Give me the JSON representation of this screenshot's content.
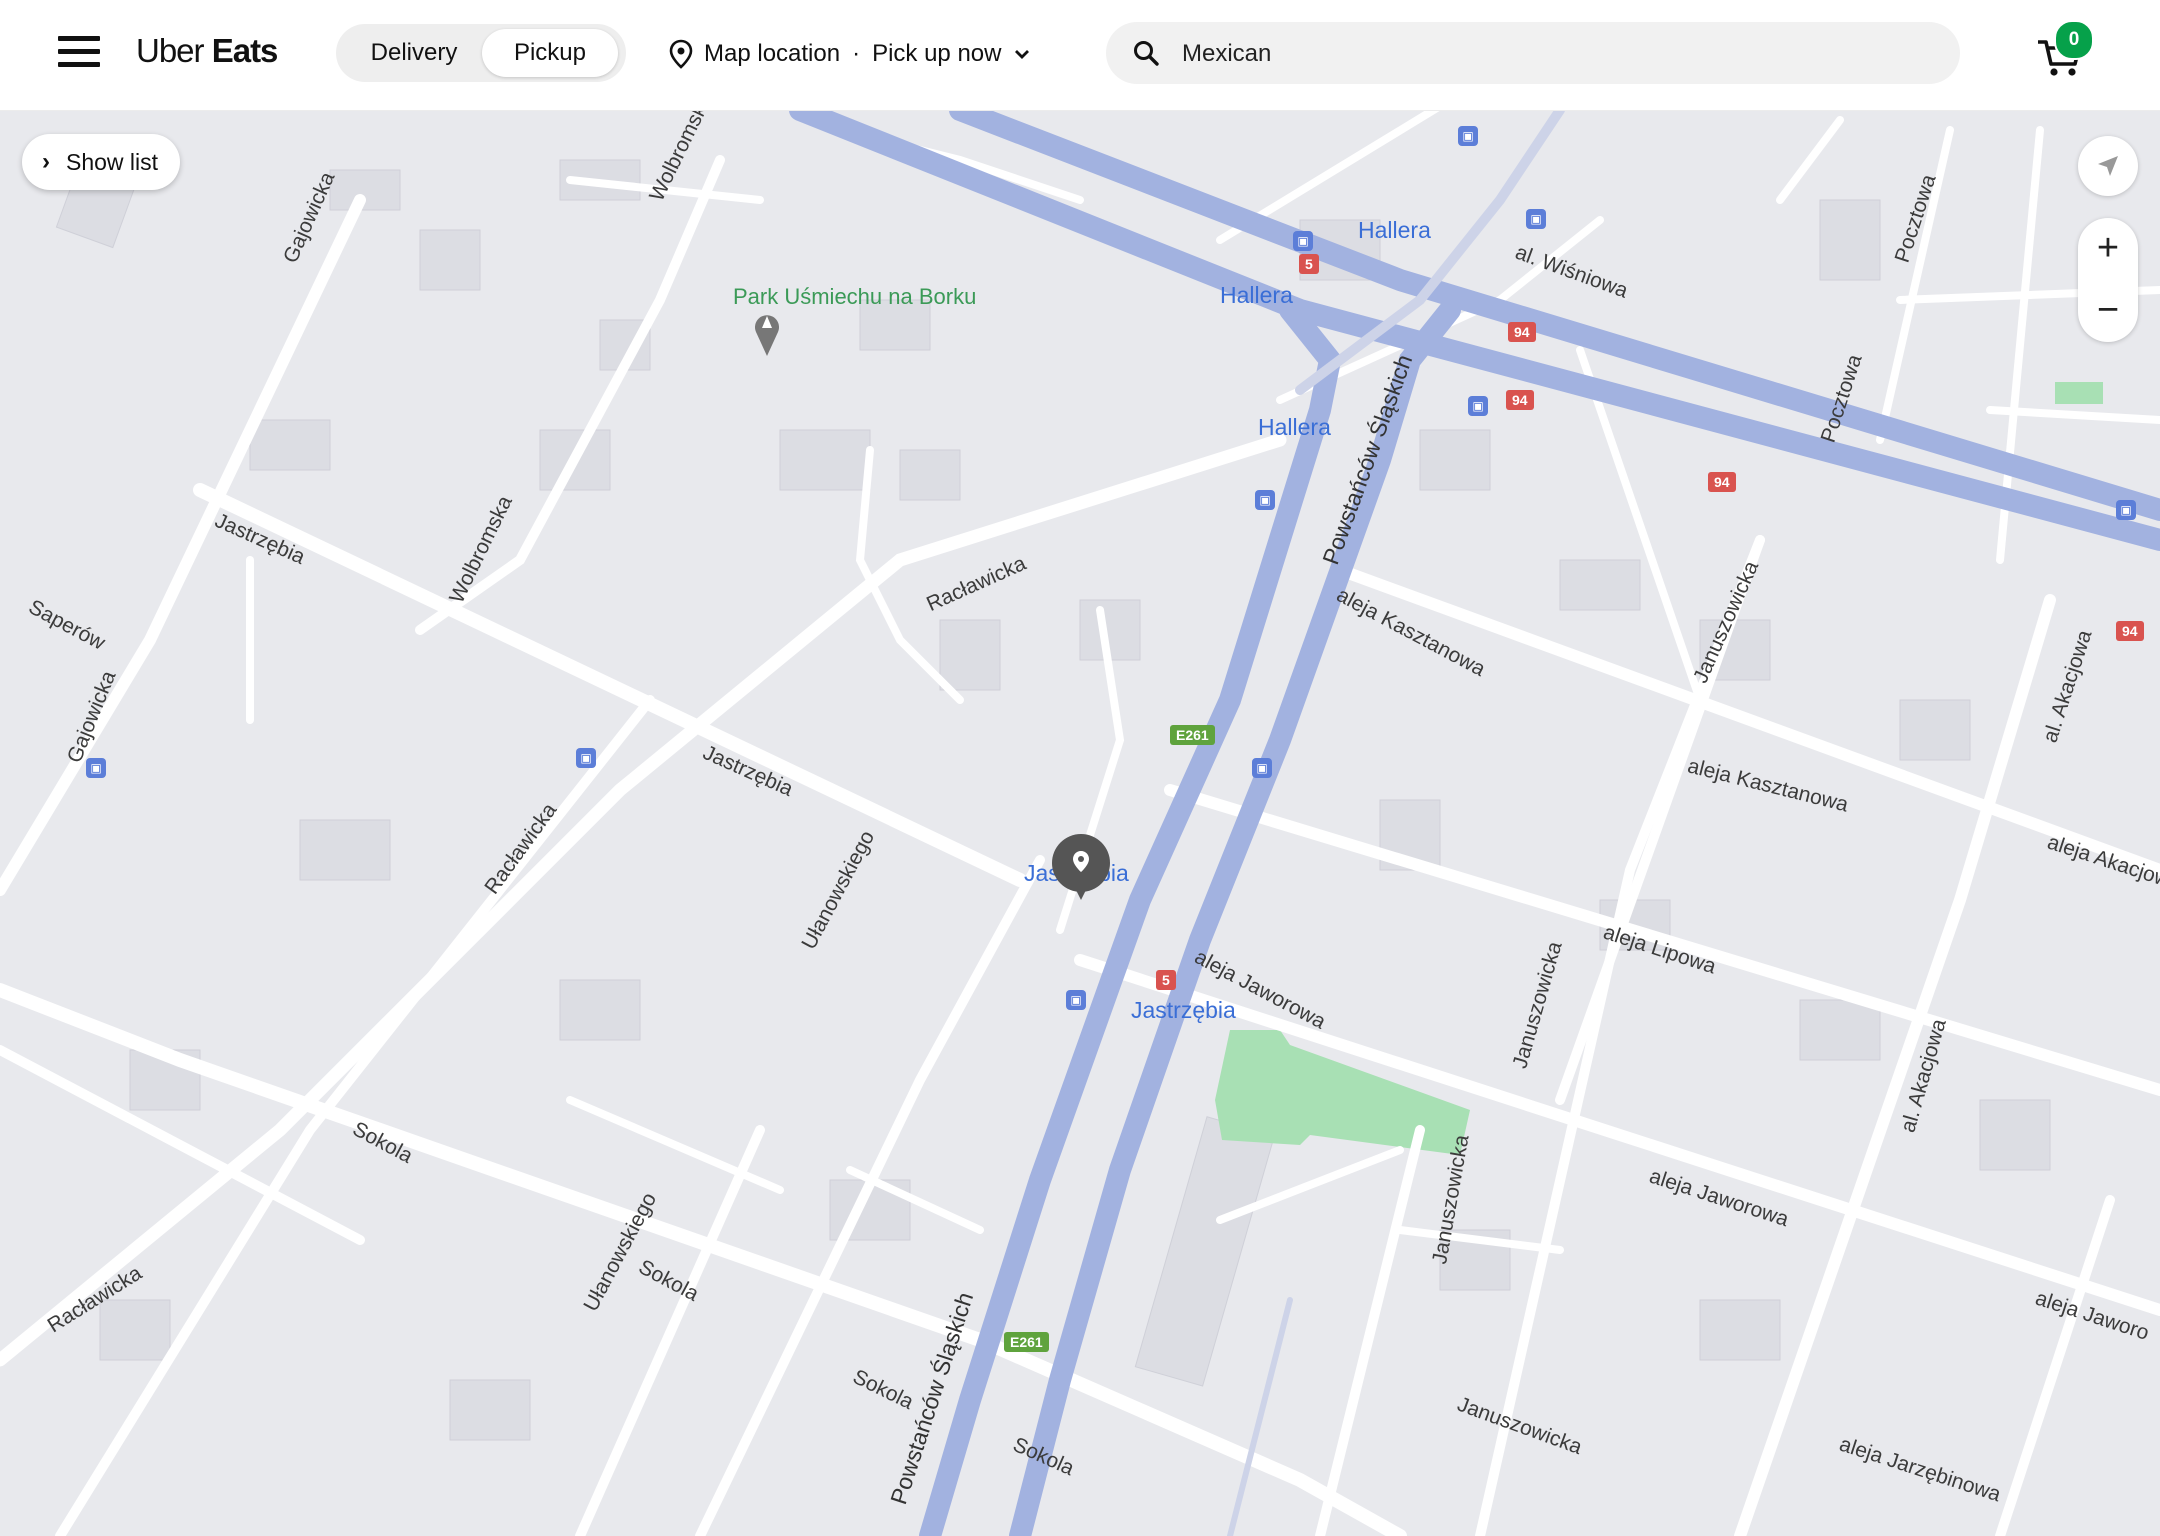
{
  "header": {
    "logo": {
      "part1": "Uber",
      "part2": "Eats"
    },
    "modes": {
      "delivery": "Delivery",
      "pickup": "Pickup",
      "selected": "Pickup"
    },
    "location": {
      "place": "Map location",
      "separator": "·",
      "time": "Pick up now"
    },
    "search": {
      "value": "Mexican"
    },
    "cart": {
      "count": "0"
    }
  },
  "map": {
    "show_list": "Show list",
    "zoom_in": "+",
    "zoom_out": "−",
    "labels": {
      "park": "Park Uśmiechu na Borku",
      "hallera1": "Hallera",
      "hallera2": "Hallera",
      "hallera3": "Hallera",
      "jastrzebia_stop1": "Jastrzębia",
      "jastrzebia_stop2": "Jastrzębia",
      "wisniowa": "al. Wiśniowa",
      "pocztowa1": "Pocztowa",
      "pocztowa2": "Pocztowa",
      "powstancow1": "Powstańców Śląskich",
      "powstancow2": "Powstańców Śląskich",
      "kasztanowa1": "aleja Kasztanowa",
      "kasztanowa2": "aleja Kasztanowa",
      "racławicka1": "Racławicka",
      "racławicka2": "Racławicka",
      "racławicka3": "Racławicka",
      "jastrzebia1": "Jastrzębia",
      "jastrzebia2": "Jastrzębia",
      "saperow": "Saperów",
      "gajowicka1": "Gajowicka",
      "gajowicka2": "Gajowicka",
      "wolbromska1": "Wolbromska",
      "wolbromska2": "Wolbromska",
      "ulanowskiego1": "Ułanowskiego",
      "ulanowskiego2": "Ułanowskiego",
      "januszowicka1": "Januszowicka",
      "januszowicka2": "Januszowicka",
      "januszowicka3": "Januszowicka",
      "januszowicka4": "Januszowicka",
      "lipowa": "aleja Lipowa",
      "jaworowa1": "aleja Jaworowa",
      "jaworowa2": "aleja Jaworowa",
      "jaworowa3": "aleja Jaworo",
      "akacjowa1": "al. Akacjowa",
      "akacjowa2": "al. Akacjowa",
      "akacjowa3": "aleja Akacjowa",
      "sokola1": "Sokola",
      "sokola2": "Sokola",
      "sokola3": "Sokola",
      "sokola4": "Sokola",
      "jarzebinowa": "aleja Jarzębinowa",
      "e261_1": "E261",
      "e261_2": "E261",
      "r94_1": "94",
      "r94_2": "94",
      "r94_3": "94",
      "r94_4": "94",
      "r5_1": "5",
      "r5_2": "5"
    }
  }
}
